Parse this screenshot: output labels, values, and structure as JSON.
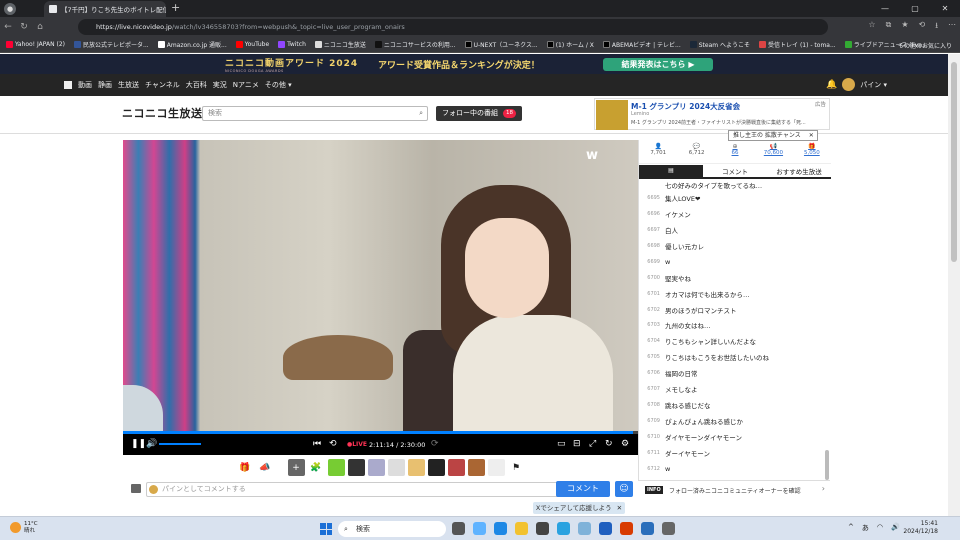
{
  "browser": {
    "tab_title": "【7千円】りこち先生のボイトレ配信",
    "url_host": "https://live.nicovideo.jp",
    "url_path": "/watch/lv346558703?from=webpush&_topic=live_user_program_onairs",
    "bookmarks": [
      "Yahoo! JAPAN (2)",
      "民放公式テレビポータ...",
      "Amazon.co.jp 通販...",
      "YouTube",
      "Twitch",
      "ニコニコ生放送",
      "ニコニコサービスの利用...",
      "U-NEXT（ユーネクス...",
      "(1) ホーム / X",
      "ABEMAビデオ | テレビ...",
      "Steam へようこそ",
      "受信トレイ (1) - toma...",
      "ライブドアニュース (live..."
    ],
    "bookmark_folder": "その他のお気に入り"
  },
  "banner": {
    "logo": "ニコニコ動画アワード 2024",
    "logo_sub": "NICONICO DOUGA AWARDS",
    "message": "アワード受賞作品＆ランキングが決定！",
    "cta": "結果発表はこちら ▶"
  },
  "sitenav": {
    "items": [
      "動画",
      "静画",
      "生放送",
      "チャンネル",
      "大百科",
      "実況",
      "Nアニメ",
      "その他 ▾"
    ],
    "user_name": "パイン ▾"
  },
  "header": {
    "logo": "ニコニコ生放送",
    "search_placeholder": "検索",
    "follow_label": "フォロー中の番組",
    "follow_count": "18"
  },
  "ad": {
    "label": "広告",
    "title": "M-1 グランプリ 2024大反省会",
    "advertiser": "Lemino",
    "desc": "M-1 グランプリ 2024前王者・ファイナリストが決勝戦直後に集結する「死..."
  },
  "player": {
    "watermark": "w",
    "live_label": "●LIVE",
    "time": "2:11:14 / 2:30:00",
    "progress_fraction": 0.99
  },
  "stats": [
    {
      "icon": "👤",
      "value": "7,701"
    },
    {
      "icon": "💬",
      "value": "6,712"
    },
    {
      "icon": "⊕",
      "value": "66"
    },
    {
      "icon": "📢",
      "value": "70,600"
    },
    {
      "icon": "🎁",
      "value": "5,050"
    }
  ],
  "tooltip": "推し主王の 拡散チャンス",
  "panel_tabs": {
    "comments": "コメント",
    "recommend": "おすすめ生放送"
  },
  "comments": [
    {
      "num": "6695",
      "text": "集人LOVE❤"
    },
    {
      "num": "6696",
      "text": "イケメン"
    },
    {
      "num": "6697",
      "text": "白人"
    },
    {
      "num": "6698",
      "text": "優しい元カレ"
    },
    {
      "num": "6699",
      "text": "w"
    },
    {
      "num": "6700",
      "text": "堅実やね"
    },
    {
      "num": "6701",
      "text": "オカマは何でも出来るから…"
    },
    {
      "num": "6702",
      "text": "男のほうがロマンチスト"
    },
    {
      "num": "6703",
      "text": "九州の女はね…"
    },
    {
      "num": "6704",
      "text": "りこちもシャン詳しいんだよな"
    },
    {
      "num": "6705",
      "text": "りこちはもこうをお世話したいのね"
    },
    {
      "num": "6706",
      "text": "福岡の日常"
    },
    {
      "num": "6707",
      "text": "メモしなよ"
    },
    {
      "num": "6708",
      "text": "跳ねる感じだな"
    },
    {
      "num": "6709",
      "text": "ぴょんぴょん跳ねる感じか"
    },
    {
      "num": "6710",
      "text": "ダイヤモーンダイヤモーン"
    },
    {
      "num": "6711",
      "text": "ダーイヤモーン"
    },
    {
      "num": "6712",
      "text": "w"
    }
  ],
  "comment_partial": "七の好みのタイプを歌ってるね…",
  "comment_bar": {
    "placeholder": "パインとしてコメントする",
    "length": "75",
    "submit": "コメント"
  },
  "info": {
    "tag": "INFO",
    "text": "フォロー済みニコニコミュニティオーナーを確認"
  },
  "share": "Xでシェアして応援しよう",
  "taskbar": {
    "temp": "11°C",
    "weather": "晴れ",
    "search": "検索",
    "time": "15:41",
    "date": "2024/12/18",
    "ime": "あ"
  }
}
